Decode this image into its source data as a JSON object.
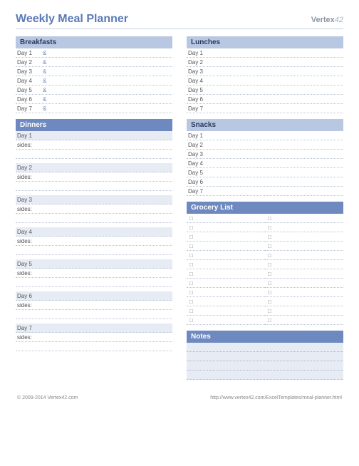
{
  "title": "Weekly Meal Planner",
  "logo_head": "Vertex",
  "logo_tail": "42",
  "sections": {
    "breakfasts": "Breakfasts",
    "lunches": "Lunches",
    "dinners": "Dinners",
    "snacks": "Snacks",
    "grocery": "Grocery List",
    "notes": "Notes"
  },
  "days": [
    "Day 1",
    "Day 2",
    "Day 3",
    "Day 4",
    "Day 5",
    "Day 6",
    "Day 7"
  ],
  "amp": "&",
  "sides": "sides:",
  "bullet": "□",
  "copyright": "© 2009-2014 Vertex42.com",
  "url": "http://www.vertex42.com/ExcelTemplates/meal-planner.html"
}
